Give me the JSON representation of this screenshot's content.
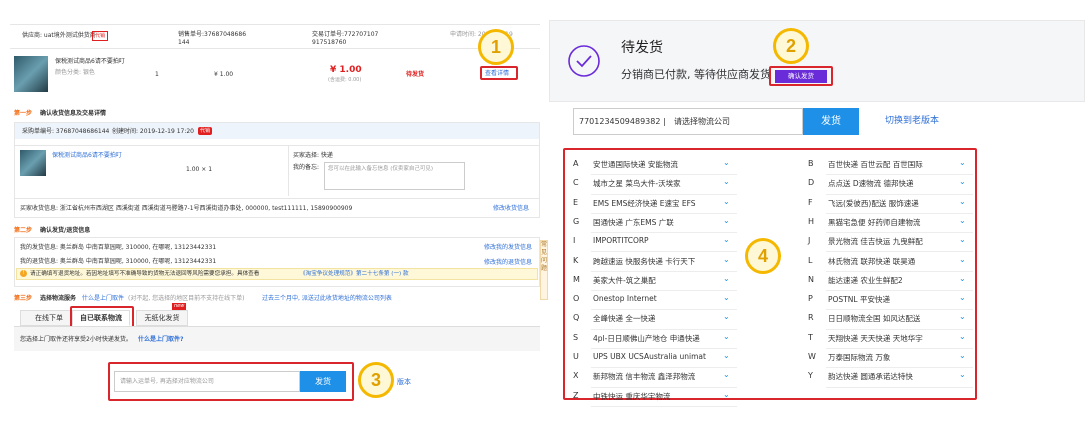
{
  "left": {
    "order": {
      "supplier": "供应商: uat境外测试供货商",
      "supplier_tag": "代销",
      "sale_no_label": "销售单号:37687048686",
      "sale_no_cont": "144",
      "trade_no_label": "交易订单号:772707107",
      "trade_no_cont": "917518760",
      "apply_time": "申请时间: 2019-12-19",
      "product_name": "保税测试商品6请不要拍叮",
      "product_color": "颜色分类: 银色",
      "qty": "1",
      "unit_price": "¥ 1.00",
      "total_price": "¥ 1.00",
      "total_sub": "(含运费: 0.00)",
      "status": "待发货",
      "detail_btn": "查看详情"
    },
    "step1": {
      "title": "第一步",
      "title_text": "确认收货信息及交易详情",
      "purchase_no": "采购单编号: 37687048686144",
      "created": "创建时间: 2019-12-19 17:20",
      "created_tag": "代销",
      "product_name": "保税测试商品6请不要拍叮",
      "qty_price": "1.00 × 1",
      "buyer_choice": "买家选择: 快递",
      "remark_label": "我的备忘:",
      "remark_placeholder": "您可以在此输入备忘信息 (仅卖家自己可见)",
      "address": "买家收货信息: 浙江省杭州市西湖区 西溪街道 西溪街道马塍路7-1号西溪街道办事处, 000000, test111111, 15890900909",
      "modify_address": "修改收货信息"
    },
    "step2": {
      "title": "第二步",
      "title_text": "确认发货/退货信息",
      "ship_info": "我的发货信息: 奥兰群岛 中南百草园呢, 310000, 在哪呢, 13123442331",
      "return_info": "我的退货信息: 奥兰群岛 中南百草园呢, 310000, 在哪呢, 13123442331",
      "modify_ship": "修改我的发货信息",
      "modify_return": "修改我的退货信息",
      "notice_a": "请正确填写退货地址。若因地址填写不准确导致的货物无法退回等风险需要您承担。具体查看",
      "notice_b": "《淘宝争议处理规范》第二十七条第 (一) 款"
    },
    "step3": {
      "title": "第三步",
      "title_text": "选择物流服务",
      "link_a": "什么是上门取件",
      "mid_text": "(对不起, 您选择的地区目前不支持在线下单)",
      "link_b": "过去三个月中, 派送过此收货地址的物流公司列表",
      "tabs": [
        "在线下单",
        "自已联系物流",
        "无纸化发货"
      ],
      "new_badge": "new",
      "pickup_text": "您选择上门取件还将享受2小时快递发货。",
      "pickup_link": "什么是上门取件?",
      "input_placeholder": "请输入运单号, 再选择对应物流公司",
      "ship_btn": "发货",
      "version_link": "版本"
    },
    "side_tab": "常见问题",
    "circles": [
      "1",
      "3"
    ]
  },
  "right": {
    "title": "待发货",
    "subtitle": "分销商已付款, 等待供应商发货",
    "confirm_btn": "确认发货",
    "tracking_no": "7701234509489382 |",
    "select_company": "请选择物流公司",
    "ship_btn": "发货",
    "switch_link": "切换到老版本",
    "circles": [
      "2",
      "4"
    ],
    "carriers_left": [
      {
        "letter": "A",
        "names": "安世通国际快递  安能物流"
      },
      {
        "letter": "C",
        "names": "城市之星  菜鸟大件-沃埃家"
      },
      {
        "letter": "E",
        "names": "EMS  EMS经济快递  E速宝  EFS"
      },
      {
        "letter": "G",
        "names": "国通快递  广东EMS  广联"
      },
      {
        "letter": "I",
        "names": "IMPORTITCORP"
      },
      {
        "letter": "K",
        "names": "跨越速运  快服务快递  卡行天下"
      },
      {
        "letter": "M",
        "names": "美家大件-筑之巢配"
      },
      {
        "letter": "O",
        "names": "Onestop Internet"
      },
      {
        "letter": "Q",
        "names": "全峰快递  全一快递"
      },
      {
        "letter": "S",
        "names": "4pl-日日顺佛山产地仓  申通快递"
      },
      {
        "letter": "U",
        "names": "UPS  UBX  UCSAustralia  unimat"
      },
      {
        "letter": "X",
        "names": "新邦物流  信丰物流  鑫泽邦物流"
      },
      {
        "letter": "Z",
        "names": "中铁快运  重庆华宇物流"
      }
    ],
    "carriers_right": [
      {
        "letter": "B",
        "names": "百世快递  百世云配  百世国际"
      },
      {
        "letter": "D",
        "names": "点点送  D速物流  德邦快递"
      },
      {
        "letter": "F",
        "names": "飞远(爱彼西)配送  服饰速递"
      },
      {
        "letter": "H",
        "names": "黑猫宅急便  好药师自建物流"
      },
      {
        "letter": "J",
        "names": "景光物流  佳吉快运  九曳鲜配"
      },
      {
        "letter": "L",
        "names": "林氏物流  联邦快递  联昊通"
      },
      {
        "letter": "N",
        "names": "能达速递  农业生鲜配2"
      },
      {
        "letter": "P",
        "names": "POSTNL  平安快递"
      },
      {
        "letter": "R",
        "names": "日日顺物流全国  如风达配送"
      },
      {
        "letter": "T",
        "names": "天翔快递  天天快递  天地华宇"
      },
      {
        "letter": "W",
        "names": "万泰国际物流  万象"
      },
      {
        "letter": "Y",
        "names": "韵达快递  圆通承诺达特快"
      }
    ]
  },
  "colors": {
    "accent": "#1e90e8",
    "red": "#d9262c",
    "purple": "#6a2bd9",
    "circle": "#f5b800"
  }
}
